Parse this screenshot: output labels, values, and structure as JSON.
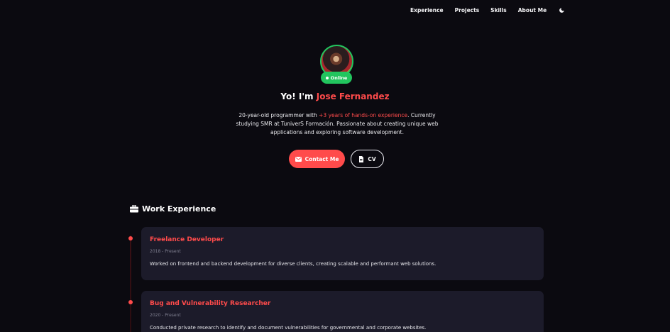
{
  "nav": {
    "items": [
      {
        "label": "Experience"
      },
      {
        "label": "Projects"
      },
      {
        "label": "Skills"
      },
      {
        "label": "About Me"
      }
    ],
    "theme_icon": "moon-icon"
  },
  "hero": {
    "status": "Online",
    "greeting_prefix": "Yo! I'm ",
    "name": "Jose Fernandez",
    "bio_before": "20-year-old programmer with ",
    "bio_highlight": "+3 years of hands-on experience",
    "bio_after": ". Currently studying SMR at TuniverS Formación. Passionate about creating unique web applications and exploring software development.",
    "contact_label": "Contact Me",
    "cv_label": "CV"
  },
  "experience": {
    "title": "Work Experience",
    "items": [
      {
        "role": "Freelance Developer",
        "date": "2018 - Present",
        "description": "Worked on frontend and backend development for diverse clients, creating scalable and performant web solutions."
      },
      {
        "role": "Bug and Vulnerability Researcher",
        "date": "2020 - Present",
        "description": "Conducted private research to identify and document vulnerabilities for governmental and corporate websites."
      }
    ]
  },
  "colors": {
    "background": "#0b0a10",
    "accent": "#ff4b4b",
    "online": "#22c55e",
    "card": "#1c1b2a"
  }
}
